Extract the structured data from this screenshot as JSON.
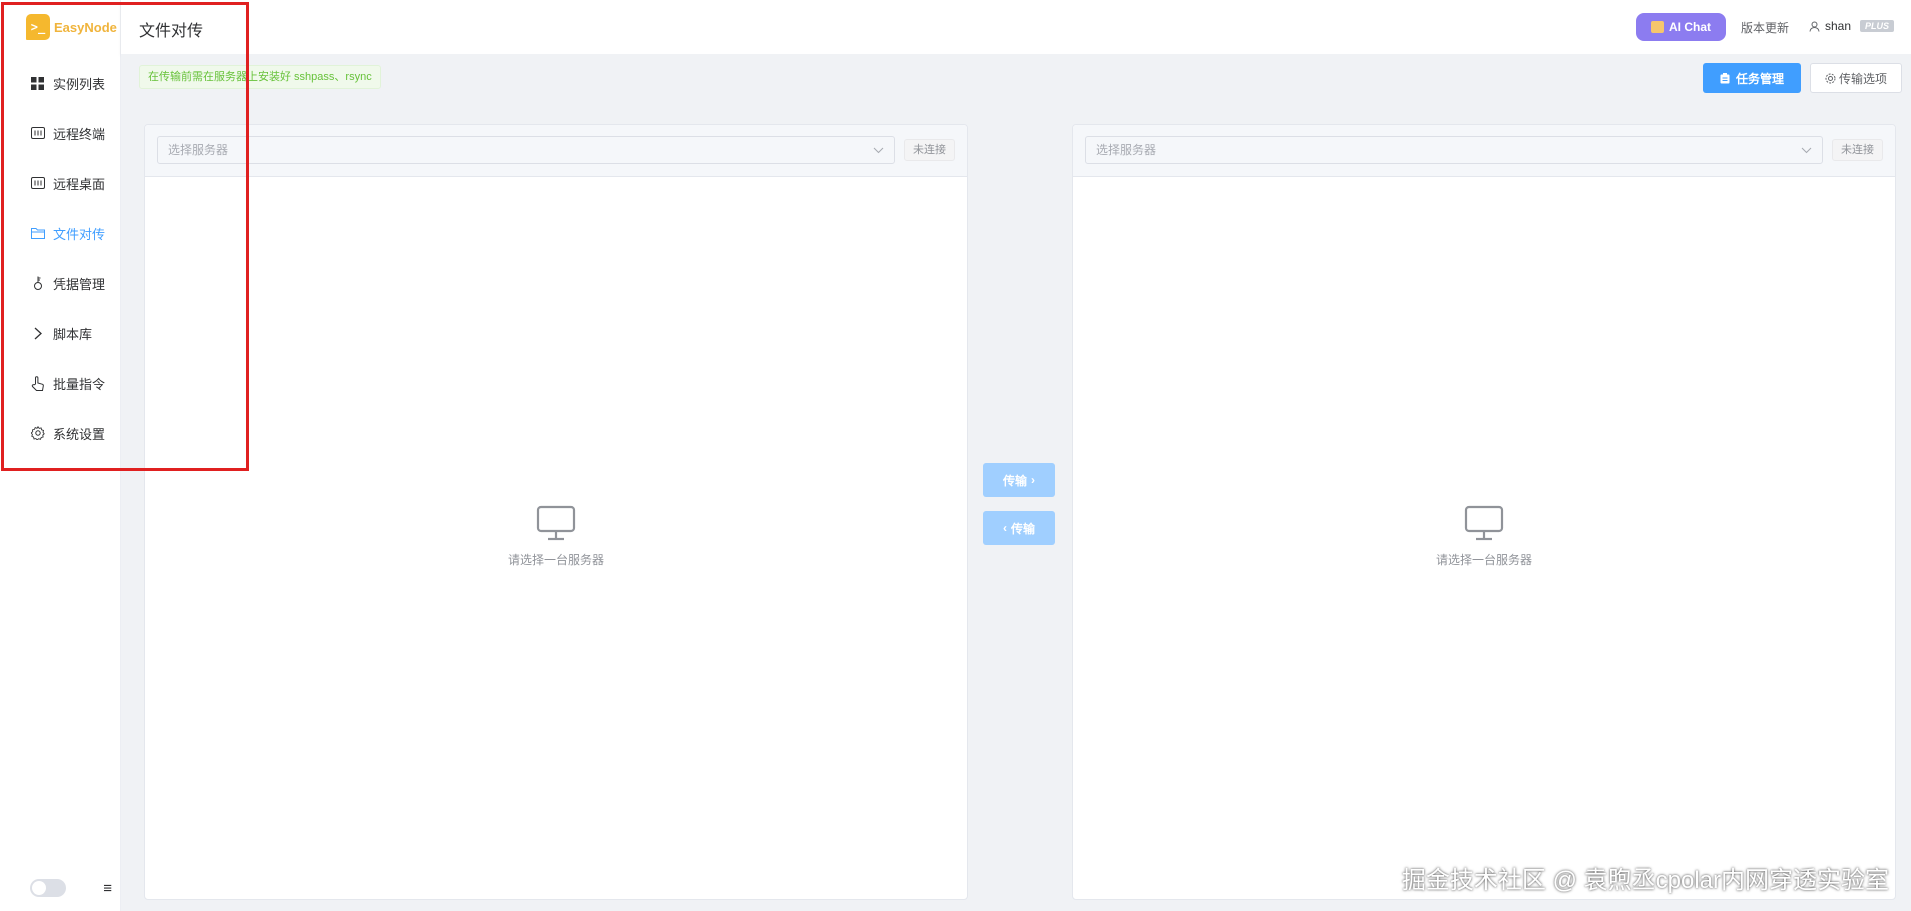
{
  "brand": {
    "name": "EasyNode",
    "mark": ">_"
  },
  "header": {
    "title": "文件对传",
    "ai_chat_label": "AI Chat",
    "update_label": "版本更新",
    "user_name": "shan",
    "plan_badge": "PLUS"
  },
  "sidebar": {
    "items": [
      {
        "label": "实例列表",
        "icon": "grid-icon"
      },
      {
        "label": "远程终端",
        "icon": "terminal-icon"
      },
      {
        "label": "远程桌面",
        "icon": "desktop-icon"
      },
      {
        "label": "文件对传",
        "icon": "folder-icon",
        "active": true
      },
      {
        "label": "凭据管理",
        "icon": "key-icon"
      },
      {
        "label": "脚本库",
        "icon": "chevron-right-icon"
      },
      {
        "label": "批量指令",
        "icon": "pointer-icon"
      },
      {
        "label": "系统设置",
        "icon": "gear-icon"
      }
    ],
    "collapse_icon": "≡"
  },
  "toolbar": {
    "hint": "在传输前需在服务器上安装好 sshpass、rsync",
    "task_button": "任务管理",
    "options_button": "传输选项"
  },
  "left_panel": {
    "select_placeholder": "选择服务器",
    "status": "未连接",
    "empty_text": "请选择一台服务器"
  },
  "right_panel": {
    "select_placeholder": "选择服务器",
    "status": "未连接",
    "empty_text": "请选择一台服务器"
  },
  "transfer": {
    "to_right": "传输",
    "to_left": "传输"
  },
  "watermark": "掘金技术社区 @ 袁煦丞cpolar内网穿透实验室",
  "colors": {
    "primary": "#409eff",
    "ai_chat": "#8c7cf0",
    "logo": "#f5b82e",
    "hint_text": "#67c23a",
    "highlight_box": "#e02020"
  }
}
